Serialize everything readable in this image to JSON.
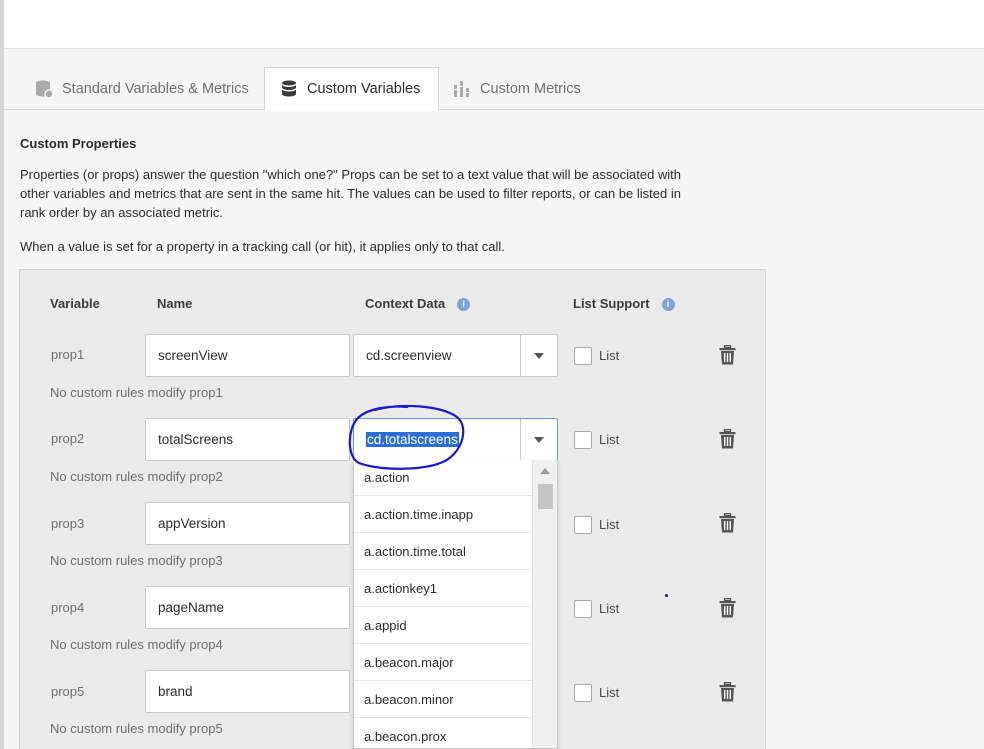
{
  "tabs": [
    {
      "label": "Standard Variables & Metrics",
      "icon": "database-icon",
      "active": false
    },
    {
      "label": "Custom Variables",
      "icon": "database-icon",
      "active": true
    },
    {
      "label": "Custom Metrics",
      "icon": "metrics-icon",
      "active": false
    }
  ],
  "section": {
    "title": "Custom Properties",
    "desc_line1": "Properties (or props) answer the question \"which one?\" Props can be set to a text value that will be associated with",
    "desc_line2": "other variables and metrics that are sent in the same hit. The values can be used to filter reports, or can be listed in",
    "desc_line3": "rank order by an associated metric.",
    "note": "When a value is set for a property in a tracking call (or hit), it applies only to that call."
  },
  "table": {
    "headers": {
      "variable": "Variable",
      "name": "Name",
      "context_data": "Context Data",
      "list_support": "List Support"
    },
    "info_glyph": "i",
    "rows": [
      {
        "variable": "prop1",
        "name": "screenView",
        "context": "cd.screenview",
        "list_label": "List",
        "rule": "No custom rules modify prop1"
      },
      {
        "variable": "prop2",
        "name": "totalScreens",
        "context": "cd.totalscreens",
        "list_label": "List",
        "rule": "No custom rules modify prop2"
      },
      {
        "variable": "prop3",
        "name": "appVersion",
        "context": "",
        "list_label": "List",
        "rule": "No custom rules modify prop3"
      },
      {
        "variable": "prop4",
        "name": "pageName",
        "context": "",
        "list_label": "List",
        "rule": "No custom rules modify prop4"
      },
      {
        "variable": "prop5",
        "name": "brand",
        "context": "",
        "list_label": "List",
        "rule": "No custom rules modify prop5"
      }
    ]
  },
  "dropdown": {
    "options": [
      "a.action",
      "a.action.time.inapp",
      "a.action.time.total",
      "a.actionkey1",
      "a.appid",
      "a.beacon.major",
      "a.beacon.minor",
      "a.beacon.prox"
    ]
  },
  "colors": {
    "accent": "#2b6fd6",
    "annotation": "#1a1acc",
    "panel_bg": "#eaeaea"
  }
}
